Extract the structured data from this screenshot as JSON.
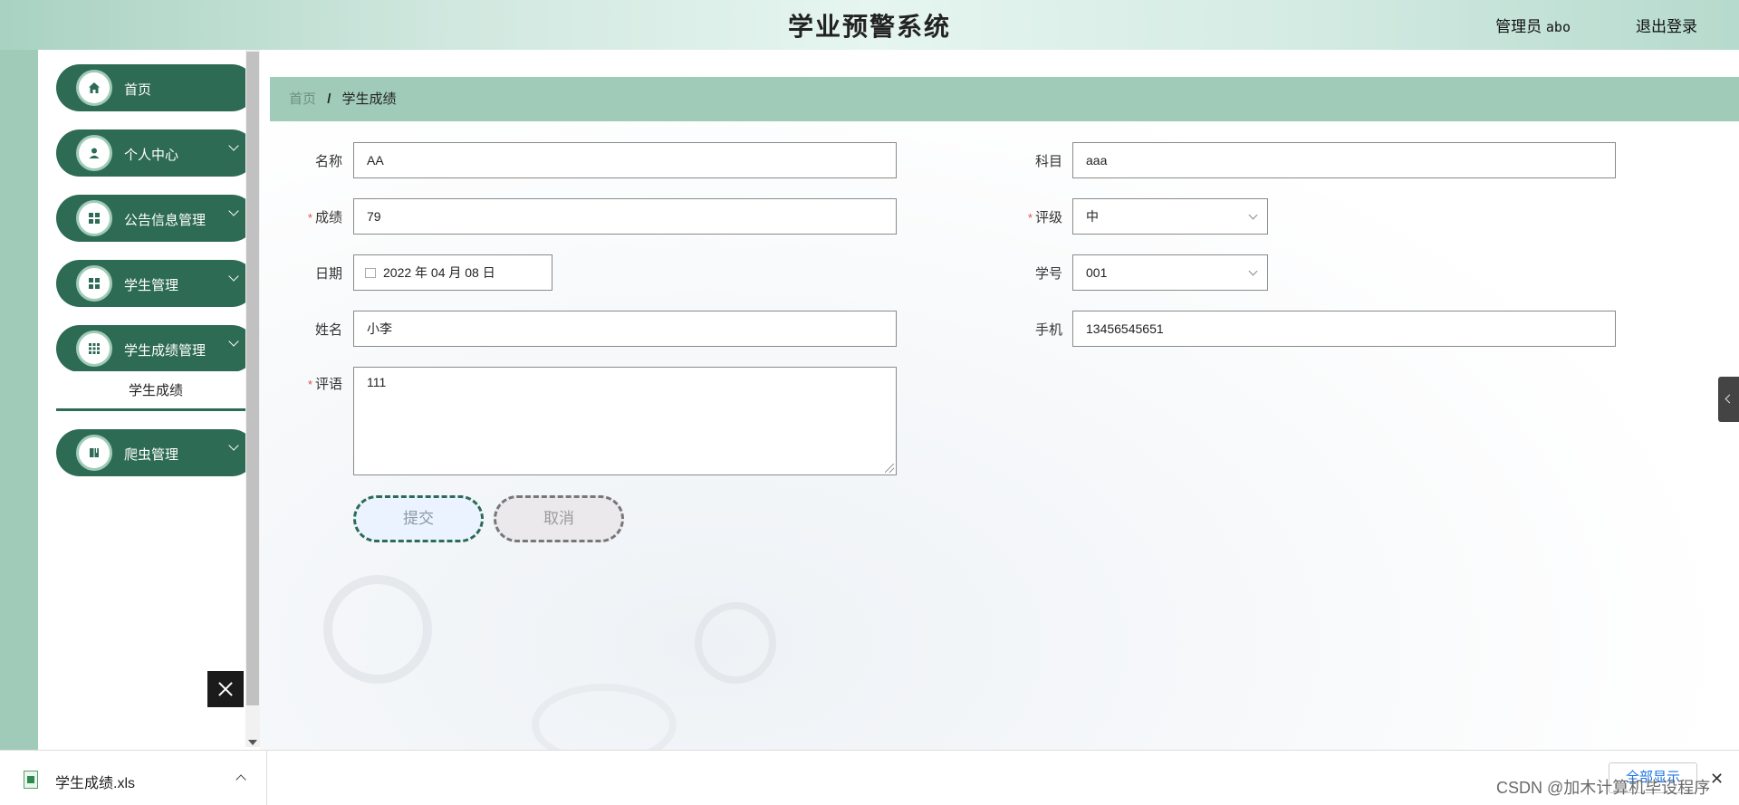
{
  "header": {
    "title": "学业预警系统",
    "role": "管理员",
    "username": "abo",
    "logout": "退出登录"
  },
  "sidebar": {
    "items": [
      {
        "label": "首页",
        "icon": "home-icon"
      },
      {
        "label": "个人中心",
        "icon": "user-icon"
      },
      {
        "label": "公告信息管理",
        "icon": "grid-icon"
      },
      {
        "label": "学生管理",
        "icon": "grid-icon"
      },
      {
        "label": "学生成绩管理",
        "icon": "apps-icon"
      },
      {
        "label": "爬虫管理",
        "icon": "book-icon"
      }
    ],
    "active_sub": "学生成绩"
  },
  "breadcrumb": {
    "home": "首页",
    "separator": "/",
    "current": "学生成绩"
  },
  "form": {
    "name": {
      "label": "名称",
      "value": "AA"
    },
    "subject": {
      "label": "科目",
      "value": "aaa"
    },
    "score": {
      "label": "成绩",
      "value": "79"
    },
    "grade": {
      "label": "评级",
      "value": "中"
    },
    "date": {
      "label": "日期",
      "value": "2022 年 04 月 08 日"
    },
    "student_no": {
      "label": "学号",
      "value": "001"
    },
    "student_name": {
      "label": "姓名",
      "value": "小李"
    },
    "phone": {
      "label": "手机",
      "value": "13456545651"
    },
    "comment": {
      "label": "评语",
      "value": "111"
    },
    "required_mark": "*",
    "submit": "提交",
    "cancel": "取消"
  },
  "downloads": {
    "file": "学生成绩.xls",
    "show_all": "全部显示",
    "close": "✕"
  },
  "watermark": "CSDN @加木计算机毕设程序",
  "colors": {
    "accent": "#2e6b54",
    "header_bg": "#cfe7de",
    "breadcrumb_bg": "#9fcbb8",
    "required": "#e0504a"
  }
}
